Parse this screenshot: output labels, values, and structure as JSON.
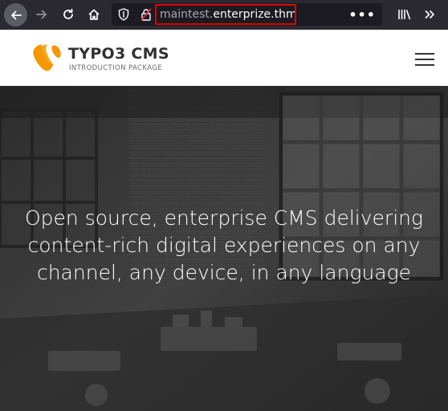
{
  "browser": {
    "url_subdomain": "maintest.",
    "url_domain": "enterprize.thm",
    "icons": {
      "back": "back-arrow-icon",
      "forward": "forward-arrow-icon",
      "reload": "reload-icon",
      "home": "home-icon",
      "shield": "tracking-protection-shield-icon",
      "lock": "insecure-lock-icon",
      "more": "page-actions-icon",
      "library": "library-icon",
      "overflow": "overflow-chevron-icon"
    },
    "more_glyph": "•••",
    "overflow_glyph": "»"
  },
  "site": {
    "logo_title": "TYPO3 CMS",
    "logo_subtitle": "INTRODUCTION PACKAGE",
    "brand_color": "#f49700",
    "menu_icon": "hamburger-menu-icon"
  },
  "hero": {
    "line1": "Open source, enterprise CMS delivering",
    "line2": "content-rich digital experiences on any",
    "line3": "channel, any device, in any language"
  }
}
